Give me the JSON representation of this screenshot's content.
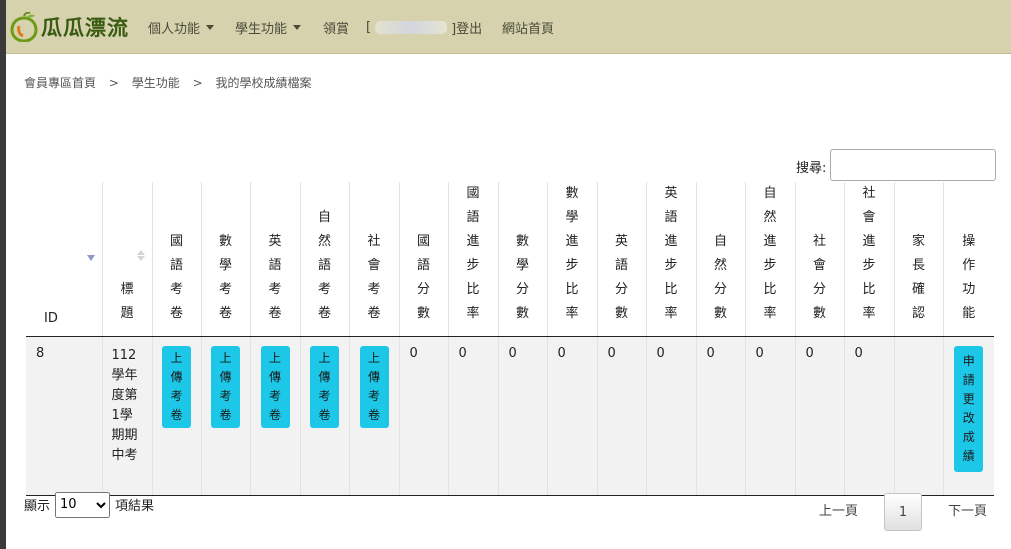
{
  "brand": {
    "name": "瓜瓜漂流",
    "logo_icon": "melon-logo-icon"
  },
  "nav": {
    "personal": "個人功能",
    "student": "學生功能",
    "reward": "領賞",
    "bracket_open": "[",
    "logout": "]登出",
    "home": "網站首頁"
  },
  "breadcrumb": {
    "items": [
      "會員專區首頁",
      "學生功能",
      "我的學校成績檔案"
    ],
    "separator": ">"
  },
  "search": {
    "label": "搜尋:",
    "value": ""
  },
  "table": {
    "headers": [
      "ID",
      "標題",
      "國語考卷",
      "數學考卷",
      "英語考卷",
      "自然語考卷",
      "社會考卷",
      "國語分數",
      "國語進步比率",
      "數學分數",
      "數學進步比率",
      "英語分數",
      "英語進步比率",
      "自然分數",
      "自然進步比率",
      "社會分數",
      "社會進步比率",
      "家長確認",
      "操作功能"
    ],
    "rows": [
      {
        "id": "8",
        "title": "112學年度第1學期期中考",
        "upload_label": "上傳考卷",
        "scores": [
          "0",
          "0",
          "0",
          "0",
          "0",
          "0",
          "0",
          "0",
          "0",
          "0"
        ],
        "parent_confirm": "",
        "action_label": "申請更改成績"
      }
    ]
  },
  "footer": {
    "show_label": "顯示",
    "page_size": "10",
    "page_size_options": [
      "10"
    ],
    "results_label": "項結果",
    "prev": "上一頁",
    "current_page": "1",
    "next": "下一頁"
  },
  "colors": {
    "navbar": "#d6d2ae",
    "button": "#1cc7e8",
    "brand": "#3a5c12"
  }
}
